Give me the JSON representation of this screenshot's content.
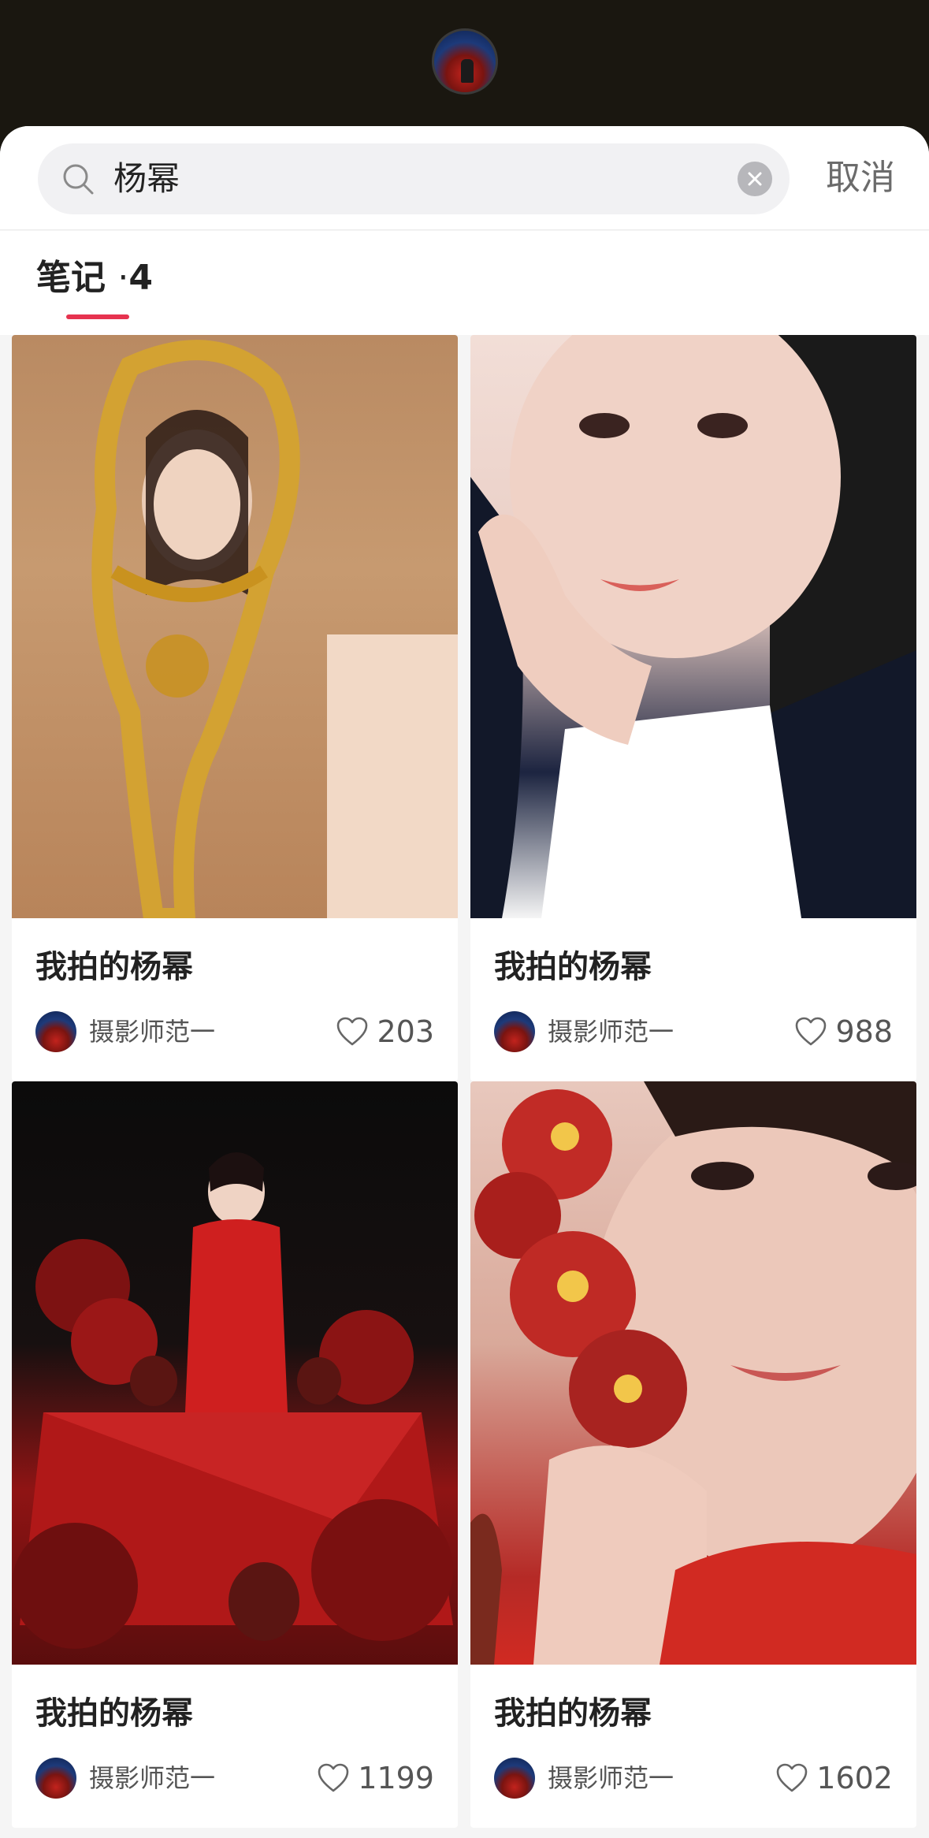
{
  "search": {
    "query": "杨幂",
    "cancel_label": "取消"
  },
  "tabs": {
    "label": "笔记",
    "separator": "·",
    "count": "4"
  },
  "notes": [
    {
      "title": "我拍的杨幂",
      "author": "摄影师范一",
      "likes": "203",
      "image": "woman-with-golden-mirror"
    },
    {
      "title": "我拍的杨幂",
      "author": "摄影师范一",
      "likes": "988",
      "image": "woman-hand-on-cheek-portrait"
    },
    {
      "title": "我拍的杨幂",
      "author": "摄影师范一",
      "likes": "1199",
      "image": "woman-in-red-dress-with-flowers"
    },
    {
      "title": "我拍的杨幂",
      "author": "摄影师范一",
      "likes": "1602",
      "image": "woman-with-red-orchids-closeup"
    }
  ],
  "colors": {
    "accent": "#e6334f",
    "header_bg": "#1a1710"
  }
}
